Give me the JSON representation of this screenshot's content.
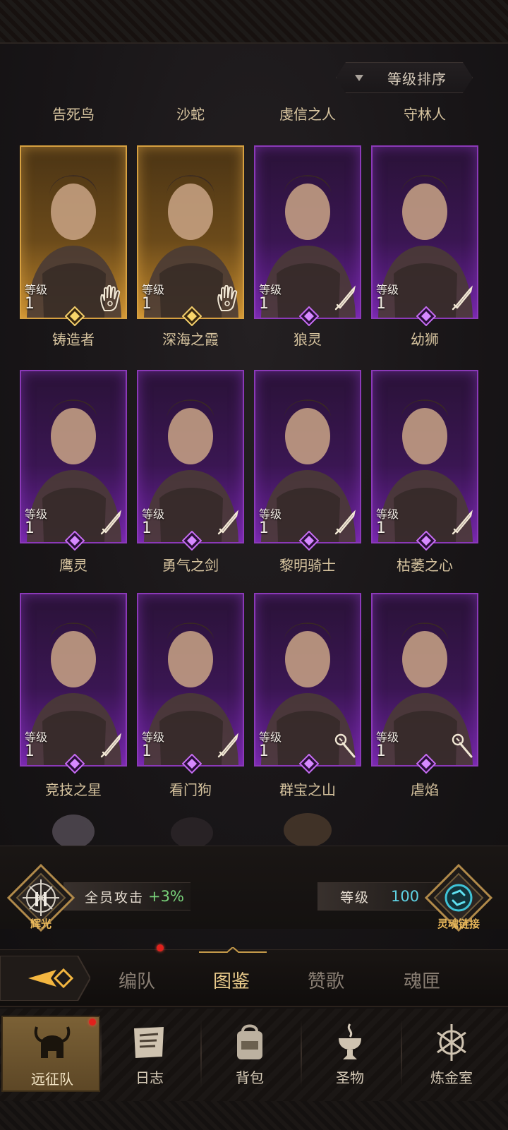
{
  "sort": {
    "label": "等级排序"
  },
  "heroes": [
    {
      "top_name": "告死鸟",
      "level_label": "等级",
      "level": "1",
      "rarity": "gold",
      "class_icon": "palm-icon"
    },
    {
      "top_name": "沙蛇",
      "level_label": "等级",
      "level": "1",
      "rarity": "gold",
      "class_icon": "palm-icon"
    },
    {
      "top_name": "虔信之人",
      "level_label": "等级",
      "level": "1",
      "rarity": "purple",
      "class_icon": "sword-icon"
    },
    {
      "top_name": "守林人",
      "level_label": "等级",
      "level": "1",
      "rarity": "purple",
      "class_icon": "sword-icon"
    },
    {
      "top_name": "铸造者",
      "level_label": "等级",
      "level": "1",
      "rarity": "purple",
      "class_icon": "sword-icon"
    },
    {
      "top_name": "深海之霞",
      "level_label": "等级",
      "level": "1",
      "rarity": "purple",
      "class_icon": "sword-icon"
    },
    {
      "top_name": "狼灵",
      "level_label": "等级",
      "level": "1",
      "rarity": "purple",
      "class_icon": "sword-icon"
    },
    {
      "top_name": "幼狮",
      "level_label": "等级",
      "level": "1",
      "rarity": "purple",
      "class_icon": "sword-icon"
    },
    {
      "top_name": "鹰灵",
      "level_label": "等级",
      "level": "1",
      "rarity": "purple",
      "class_icon": "sword-icon"
    },
    {
      "top_name": "勇气之剑",
      "level_label": "等级",
      "level": "1",
      "rarity": "purple",
      "class_icon": "sword-icon"
    },
    {
      "top_name": "黎明骑士",
      "level_label": "等级",
      "level": "1",
      "rarity": "purple",
      "class_icon": "staff-icon"
    },
    {
      "top_name": "枯萎之心",
      "level_label": "等级",
      "level": "1",
      "rarity": "purple",
      "class_icon": "staff-icon"
    }
  ],
  "bottom_names": [
    "竞技之星",
    "看门狗",
    "群宝之山",
    "虐焰"
  ],
  "bonus": {
    "emblem_label": "辉光",
    "text": "全员攻击",
    "value": "+3%",
    "level_label": "等级",
    "level_value": "100",
    "link_label": "灵魂链接"
  },
  "subtabs": [
    {
      "label": "编队",
      "badge": true
    },
    {
      "label": "图鉴",
      "active": true
    },
    {
      "label": "赞歌"
    },
    {
      "label": "魂匣"
    }
  ],
  "nav": [
    {
      "label": "远征队",
      "icon": "helmet-icon",
      "active": true,
      "badge": true
    },
    {
      "label": "日志",
      "icon": "scroll-icon"
    },
    {
      "label": "背包",
      "icon": "bag-icon"
    },
    {
      "label": "圣物",
      "icon": "chalice-icon"
    },
    {
      "label": "炼金室",
      "icon": "alchemy-icon"
    }
  ],
  "colors": {
    "gold_frame": "#d6a040",
    "purple_frame": "#8b39b8",
    "bonus_green": "#79d37a",
    "level_cyan": "#5fd3e4",
    "badge_red": "#e0211c"
  }
}
